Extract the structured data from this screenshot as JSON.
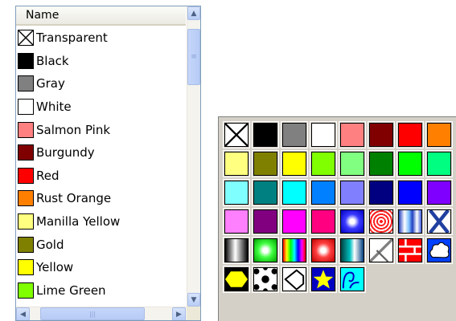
{
  "list": {
    "header": "Name",
    "items": [
      {
        "name": "Transparent",
        "color": "transparent"
      },
      {
        "name": "Black",
        "color": "#000000"
      },
      {
        "name": "Gray",
        "color": "#808080"
      },
      {
        "name": "White",
        "color": "#ffffff"
      },
      {
        "name": "Salmon Pink",
        "color": "#ff8080"
      },
      {
        "name": "Burgundy",
        "color": "#800000"
      },
      {
        "name": "Red",
        "color": "#ff0000"
      },
      {
        "name": "Rust Orange",
        "color": "#ff8000"
      },
      {
        "name": "Manilla Yellow",
        "color": "#ffff80"
      },
      {
        "name": "Gold",
        "color": "#808000"
      },
      {
        "name": "Yellow",
        "color": "#ffff00"
      },
      {
        "name": "Lime Green",
        "color": "#80ff00"
      }
    ]
  },
  "palette": {
    "rows": [
      [
        "transparent",
        "#000000",
        "#808080",
        "#ffffff",
        "#ff8080",
        "#800000",
        "#ff0000",
        "#ff8000"
      ],
      [
        "#ffff80",
        "#808000",
        "#ffff00",
        "#80ff00",
        "#80ff80",
        "#008000",
        "#00ff00",
        "#00ff80"
      ],
      [
        "#80ffff",
        "#008080",
        "#00ffff",
        "#0080ff",
        "#8080ff",
        "#000080",
        "#0000ff",
        "#8000ff"
      ],
      [
        "#ff80ff",
        "#800080",
        "#ff00ff",
        "#ff0080",
        "pattern-blue-radial",
        "pattern-red-target",
        "pattern-blue-stripes",
        "pattern-blue-cross"
      ],
      [
        "pattern-gray-gradient",
        "pattern-green-radial",
        "pattern-rainbow",
        "pattern-red-radial",
        "pattern-teal-gradient",
        "pattern-diagonal",
        "pattern-red-bricks",
        "pattern-cloud"
      ],
      [
        "pattern-yellow-hexagon",
        "pattern-soccer-ball",
        "pattern-outline-shape",
        "pattern-star",
        "pattern-cyan-wave"
      ]
    ]
  }
}
